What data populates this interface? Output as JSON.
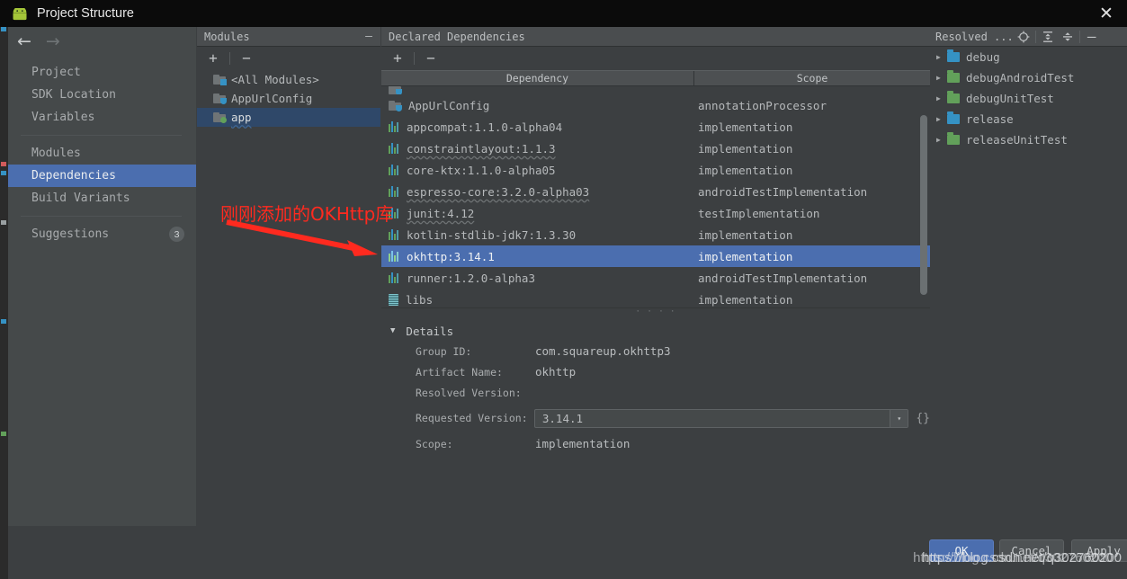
{
  "window": {
    "title": "Project Structure",
    "app_icon": "android-robot-icon",
    "close_label": "✕"
  },
  "nav": {
    "back_icon": "←",
    "forward_icon": "→"
  },
  "sidebar": {
    "items": [
      {
        "label": "Project",
        "selected": false,
        "badge": ""
      },
      {
        "label": "SDK Location",
        "selected": false,
        "badge": ""
      },
      {
        "label": "Variables",
        "selected": false,
        "badge": ""
      },
      {
        "label": "Modules",
        "selected": false,
        "badge": ""
      },
      {
        "label": "Dependencies",
        "selected": true,
        "badge": ""
      },
      {
        "label": "Build Variants",
        "selected": false,
        "badge": ""
      },
      {
        "label": "Suggestions",
        "selected": false,
        "badge": "3"
      }
    ]
  },
  "modules_panel": {
    "title": "Modules",
    "minimize_icon": "—",
    "add_icon": "+",
    "remove_icon": "−",
    "rows": [
      {
        "label": "<All Modules>",
        "selected": false,
        "icon": "all-modules-folder-icon"
      },
      {
        "label": "AppUrlConfig",
        "selected": false,
        "icon": "module-folder-icon"
      },
      {
        "label": "app",
        "selected": true,
        "icon": "app-module-folder-icon"
      }
    ]
  },
  "deps_panel": {
    "title": "Declared Dependencies",
    "add_icon": "+",
    "remove_icon": "−",
    "columns": {
      "dependency": "Dependency",
      "scope": "Scope"
    },
    "rows": [
      {
        "name": "AppUrlConfig",
        "scope": "annotationProcessor",
        "icon": "module-folder-icon",
        "selected": false,
        "wavy": false
      },
      {
        "name": "appcompat:1.1.0-alpha04",
        "scope": "implementation",
        "icon": "library-icon",
        "selected": false,
        "wavy": false
      },
      {
        "name": "constraintlayout:1.1.3",
        "scope": "implementation",
        "icon": "library-icon",
        "selected": false,
        "wavy": true
      },
      {
        "name": "core-ktx:1.1.0-alpha05",
        "scope": "implementation",
        "icon": "library-icon",
        "selected": false,
        "wavy": false
      },
      {
        "name": "espresso-core:3.2.0-alpha03",
        "scope": "androidTestImplementation",
        "icon": "library-icon",
        "selected": false,
        "wavy": true
      },
      {
        "name": "junit:4.12",
        "scope": "testImplementation",
        "icon": "library-icon",
        "selected": false,
        "wavy": true
      },
      {
        "name": "kotlin-stdlib-jdk7:1.3.30",
        "scope": "implementation",
        "icon": "library-icon",
        "selected": false,
        "wavy": false
      },
      {
        "name": "okhttp:3.14.1",
        "scope": "implementation",
        "icon": "library-icon",
        "selected": true,
        "wavy": false
      },
      {
        "name": "runner:1.2.0-alpha3",
        "scope": "androidTestImplementation",
        "icon": "library-icon",
        "selected": false,
        "wavy": false
      },
      {
        "name": "libs",
        "scope": "implementation",
        "icon": "jar-file-icon",
        "selected": false,
        "wavy": false
      }
    ]
  },
  "details": {
    "title": "Details",
    "expand_icon": "▼",
    "group_id_label": "Group ID:",
    "group_id_value": "com.squareup.okhttp3",
    "artifact_label": "Artifact Name:",
    "artifact_value": "okhttp",
    "resolved_label": "Resolved Version:",
    "resolved_value": "",
    "requested_label": "Requested Version:",
    "requested_value": "3.14.1",
    "requested_dropdown_icon": "▾",
    "brace_icon": "{}",
    "scope_label": "Scope:",
    "scope_value": "implementation"
  },
  "resolved_panel": {
    "title": "Resolved ...",
    "icons": {
      "locate": "target-icon",
      "expand_all": "expand-all-icon",
      "collapse_all": "collapse-all-icon",
      "minimize": "—"
    },
    "rows": [
      {
        "label": "debug",
        "tri": "▶",
        "color": "#3592c4"
      },
      {
        "label": "debugAndroidTest",
        "tri": "▶",
        "color": "#62a05a"
      },
      {
        "label": "debugUnitTest",
        "tri": "▶",
        "color": "#62a05a"
      },
      {
        "label": "release",
        "tri": "▶",
        "color": "#3592c4"
      },
      {
        "label": "releaseUnitTest",
        "tri": "▶",
        "color": "#62a05a"
      }
    ]
  },
  "buttons": {
    "ok": "OK",
    "cancel": "Cancel",
    "apply_pre": "A",
    "apply_post": "pply"
  },
  "annotation": {
    "text": "刚刚添加的OKHttp库",
    "color": "#ff2a1f",
    "arrow": "red-arrow-icon"
  },
  "watermark": {
    "line1": "https://blog.csdn.net/q302760200",
    "line2": "https://blog.csdn.net/q302760200"
  },
  "colors": {
    "accent": "#4b6eaf",
    "panel_bg": "#3c3f41",
    "sidebar_bg": "#45494a",
    "titlebar_bg": "#0b0b0b"
  }
}
